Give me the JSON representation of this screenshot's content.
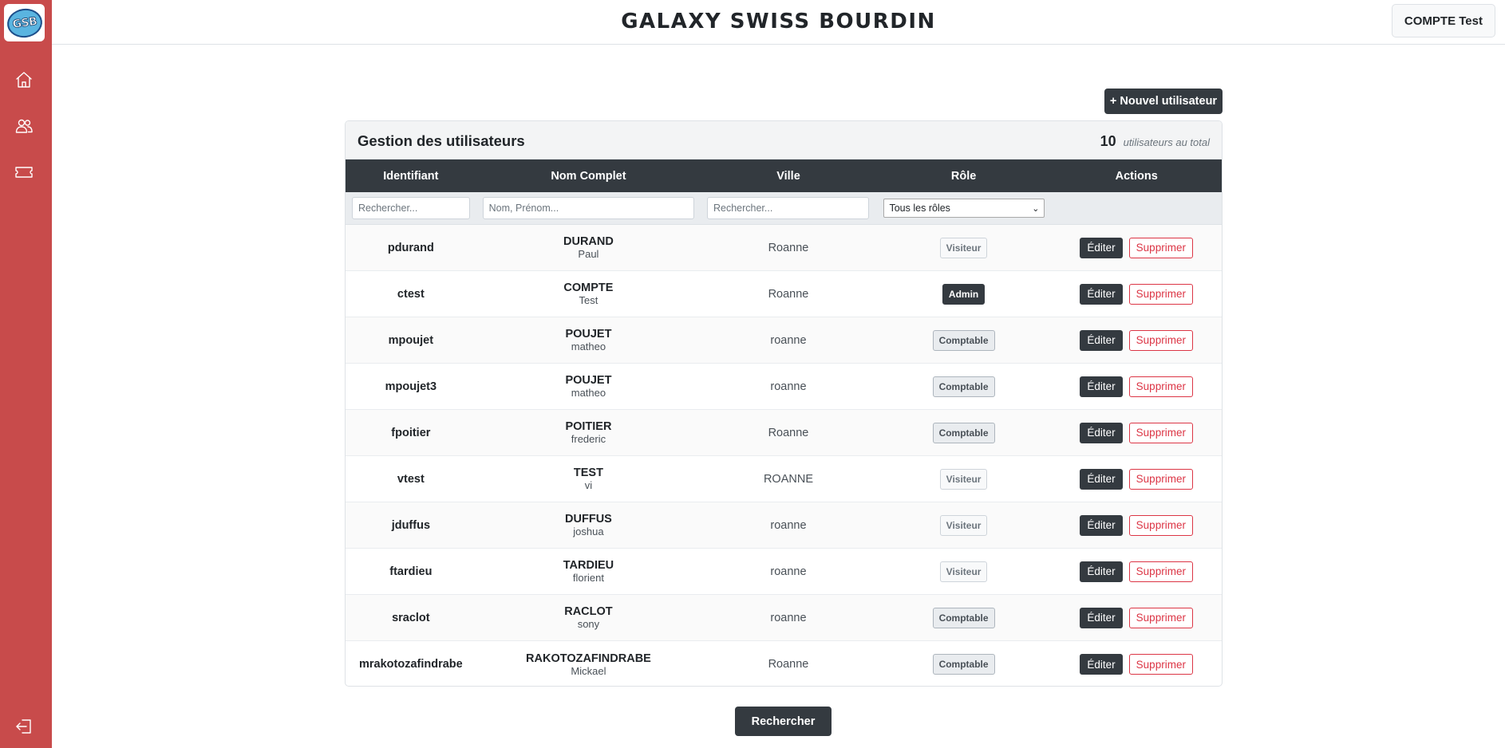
{
  "sidebar": {
    "logo_text": "GSB",
    "items": [
      {
        "name": "home-icon"
      },
      {
        "name": "users-icon"
      },
      {
        "name": "ticket-icon"
      }
    ],
    "logout_icon": "logout-icon"
  },
  "header": {
    "title": "GALAXY SWISS BOURDIN",
    "account_label": "COMPTE Test"
  },
  "main": {
    "new_user_label": "+ Nouvel utilisateur",
    "card_title": "Gestion des utilisateurs",
    "total_count": "10",
    "total_label": "utilisateurs au total",
    "columns": [
      "Identifiant",
      "Nom Complet",
      "Ville",
      "Rôle",
      "Actions"
    ],
    "filters": {
      "ident_placeholder": "Rechercher...",
      "name_placeholder": "Nom, Prénom...",
      "city_placeholder": "Rechercher...",
      "role_selected": "Tous les rôles"
    },
    "edit_label": "Éditer",
    "delete_label": "Supprimer",
    "search_button": "Rechercher",
    "rows": [
      {
        "id": "pdurand",
        "last": "DURAND",
        "first": "Paul",
        "city": "Roanne",
        "role": "Visiteur"
      },
      {
        "id": "ctest",
        "last": "COMPTE",
        "first": "Test",
        "city": "Roanne",
        "role": "Admin"
      },
      {
        "id": "mpoujet",
        "last": "POUJET",
        "first": "matheo",
        "city": "roanne",
        "role": "Comptable"
      },
      {
        "id": "mpoujet3",
        "last": "POUJET",
        "first": "matheo",
        "city": "roanne",
        "role": "Comptable"
      },
      {
        "id": "fpoitier",
        "last": "POITIER",
        "first": "frederic",
        "city": "Roanne",
        "role": "Comptable"
      },
      {
        "id": "vtest",
        "last": "TEST",
        "first": "vi",
        "city": "ROANNE",
        "role": "Visiteur"
      },
      {
        "id": "jduffus",
        "last": "DUFFUS",
        "first": "joshua",
        "city": "roanne",
        "role": "Visiteur"
      },
      {
        "id": "ftardieu",
        "last": "TARDIEU",
        "first": "florient",
        "city": "roanne",
        "role": "Visiteur"
      },
      {
        "id": "sraclot",
        "last": "RACLOT",
        "first": "sony",
        "city": "roanne",
        "role": "Comptable"
      },
      {
        "id": "mrakotozafindrabe",
        "last": "RAKOTOZAFINDRABE",
        "first": "Mickael",
        "city": "Roanne",
        "role": "Comptable"
      }
    ]
  },
  "colors": {
    "sidebar": "#c84b4b",
    "dark": "#343a40",
    "danger": "#dc3545"
  }
}
